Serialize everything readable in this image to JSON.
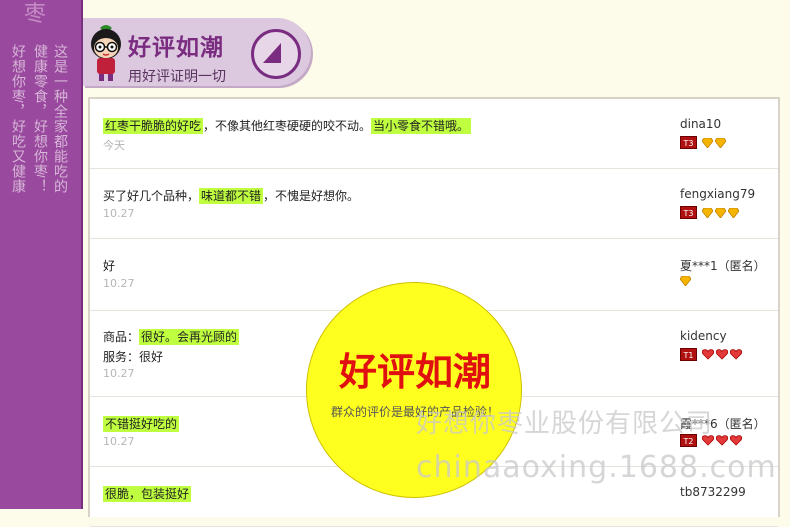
{
  "rail": {
    "top_glyph": "枣",
    "col1": "这是一种全家都能吃的",
    "col2": "健康零食，好想你枣！",
    "col3": "好想你枣，好吃又健康"
  },
  "banner": {
    "title": "好评如潮",
    "subtitle": "用好评证明一切"
  },
  "comments": [
    {
      "segments": [
        {
          "text": "红枣干脆脆的好吃",
          "hl": true
        },
        {
          "text": "，不像其他红枣硬硬的咬不动。",
          "hl": false
        },
        {
          "text": "当小零食不错哦。",
          "hl": true
        }
      ],
      "date": "今天",
      "user": "dina10",
      "level": "T3",
      "icons": 2,
      "icon_type": "diamond"
    },
    {
      "segments": [
        {
          "text": "买了好几个品种，",
          "hl": false
        },
        {
          "text": "味道都不错",
          "hl": true
        },
        {
          "text": "，不愧是好想你。",
          "hl": false
        }
      ],
      "date": "10.27",
      "user": "fengxiang79",
      "level": "T3",
      "icons": 3,
      "icon_type": "diamond"
    },
    {
      "segments": [
        {
          "text": "好",
          "hl": false
        }
      ],
      "date": "10.27",
      "user": "夏***1（匿名）",
      "level": "",
      "icons": 1,
      "icon_type": "diamond"
    },
    {
      "segments": [
        {
          "text": "商品：",
          "hl": false
        },
        {
          "text": "很好。会再光顾的",
          "hl": true
        }
      ],
      "line2": "服务：很好",
      "date": "10.27",
      "user": "kidency",
      "level": "T1",
      "icons": 3,
      "icon_type": "heart"
    },
    {
      "segments": [
        {
          "text": "不错挺好吃的",
          "hl": true
        }
      ],
      "date": "10.27",
      "user": "霞***6（匿名）",
      "level": "T2",
      "icons": 3,
      "icon_type": "heart"
    },
    {
      "segments": [
        {
          "text": "很脆，包装挺好",
          "hl": true
        }
      ],
      "date": "",
      "user": "tb8732299",
      "level": "",
      "icons": 0,
      "icon_type": "heart"
    }
  ],
  "circle": {
    "title": "好评如潮",
    "subtitle": "群众的评价是最好的产品检验！"
  },
  "watermark": {
    "company": "好想你枣业股份有限公司",
    "site": "chinaaoxing.1688.com"
  },
  "colors": {
    "rail": "#9a4a9e",
    "highlight": "#bfff3f",
    "circle": "#ffff1f",
    "circle_text": "#e01010"
  }
}
